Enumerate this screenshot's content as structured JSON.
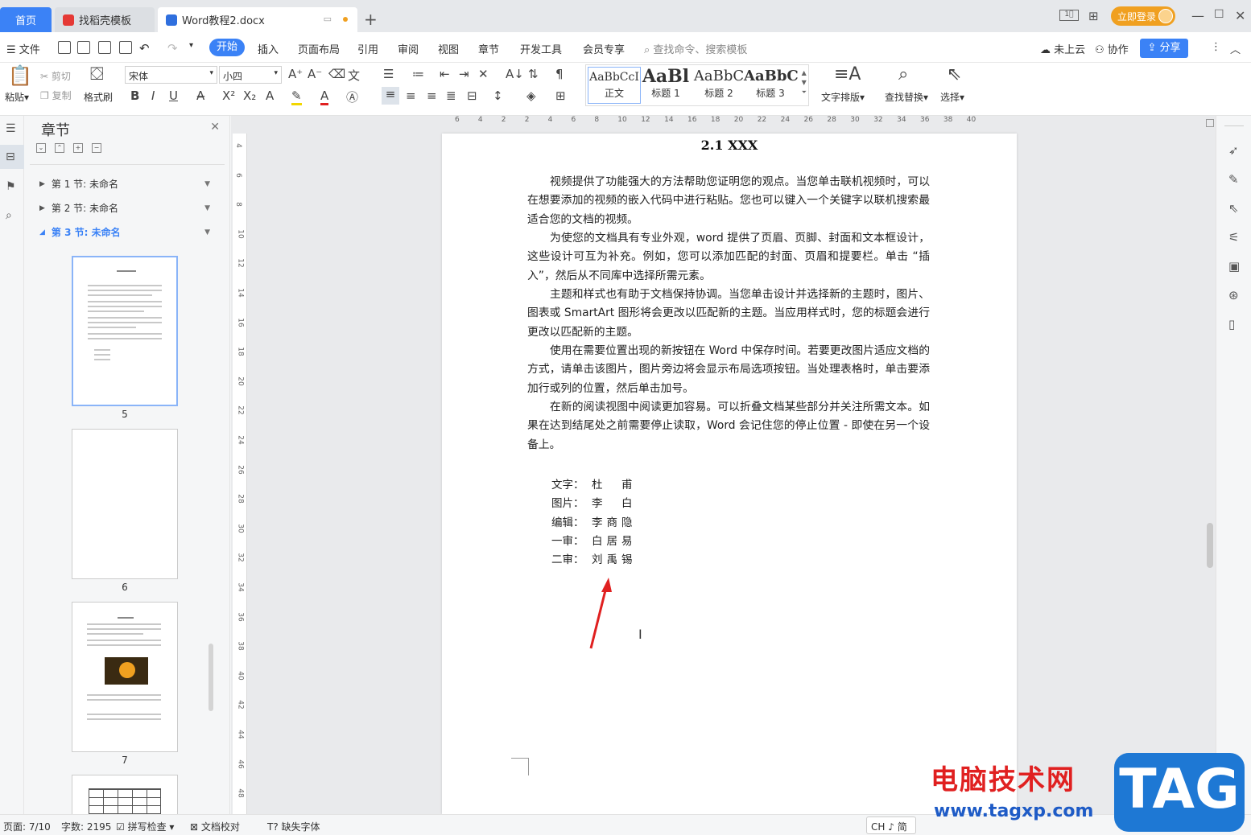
{
  "tabs": {
    "home": "首页",
    "template": "找稻壳模板",
    "document": "Word教程2.docx",
    "login": "立即登录"
  },
  "menu": {
    "file": "文件",
    "items": [
      "开始",
      "插入",
      "页面布局",
      "引用",
      "审阅",
      "视图",
      "章节",
      "开发工具",
      "会员专享"
    ],
    "search": "查找命令、搜索模板",
    "cloud": "未上云",
    "collab": "协作",
    "share": "分享"
  },
  "ribbon": {
    "paste": "粘贴",
    "cut": "剪切",
    "copy": "复制",
    "format_painter": "格式刷",
    "font_name": "宋体",
    "font_size": "小四",
    "styles": [
      {
        "preview": "AaBbCcI",
        "label": "正文"
      },
      {
        "preview": "AaBl",
        "label": "标题 1"
      },
      {
        "preview": "AaBbC",
        "label": "标题 2"
      },
      {
        "preview": "AaBbC",
        "label": "标题 3"
      }
    ],
    "text_layout": "文字排版",
    "find_replace": "查找替换",
    "select": "选择"
  },
  "nav": {
    "title": "章节",
    "sections": [
      "第 1 节: 未命名",
      "第 2 节: 未命名",
      "第 3 节: 未命名"
    ],
    "pages": [
      "5",
      "6",
      "7"
    ]
  },
  "ruler": {
    "h": [
      "6",
      "4",
      "2",
      "2",
      "4",
      "6",
      "8",
      "10",
      "12",
      "14",
      "16",
      "18",
      "20",
      "22",
      "24",
      "26",
      "28",
      "30",
      "32",
      "34",
      "36",
      "38",
      "40"
    ],
    "v": [
      "4",
      "6",
      "8",
      "10",
      "12",
      "14",
      "16",
      "18",
      "20",
      "22",
      "24",
      "26",
      "28",
      "30",
      "32",
      "34",
      "36",
      "38",
      "40",
      "42",
      "44",
      "46",
      "48"
    ]
  },
  "document": {
    "heading": "2.1 XXX",
    "paragraphs": [
      "视频提供了功能强大的方法帮助您证明您的观点。当您单击联机视频时，可以在想要添加的视频的嵌入代码中进行粘贴。您也可以键入一个关键字以联机搜索最适合您的文档的视频。",
      "为使您的文档具有专业外观，word 提供了页眉、页脚、封面和文本框设计，这些设计可互为补充。例如，您可以添加匹配的封面、页眉和提要栏。单击 “插入”，然后从不同库中选择所需元素。",
      "主题和样式也有助于文档保持协调。当您单击设计并选择新的主题时，图片、图表或 SmartArt 图形将会更改以匹配新的主题。当应用样式时，您的标题会进行更改以匹配新的主题。",
      "使用在需要位置出现的新按钮在 Word 中保存时间。若要更改图片适应文档的方式，请单击该图片，图片旁边将会显示布局选项按钮。当处理表格时，单击要添加行或列的位置，然后单击加号。",
      "在新的阅读视图中阅读更加容易。可以折叠文档某些部分并关注所需文本。如果在达到结尾处之前需要停止读取，Word 会记住您的停止位置 - 即使在另一个设备上。"
    ],
    "credits": [
      {
        "key": "文字：",
        "value": "杜　甫"
      },
      {
        "key": "图片：",
        "value": "李　白"
      },
      {
        "key": "编辑：",
        "value": "李商隐"
      },
      {
        "key": "一审：",
        "value": "白居易"
      },
      {
        "key": "二审：",
        "value": "刘禹锡"
      }
    ]
  },
  "status": {
    "page": "页面: 7/10",
    "words": "字数: 2195",
    "spell": "拼写检查",
    "proof": "文档校对",
    "missing_font": "缺失字体",
    "ime": "CH ♪ 简"
  },
  "watermark": {
    "site_name": "电脑技术网",
    "url": "www.tagxp.com",
    "tag": "TAG"
  },
  "colors": {
    "accent": "#3b82f6",
    "login": "#f0a020",
    "arrow": "#e02020"
  }
}
